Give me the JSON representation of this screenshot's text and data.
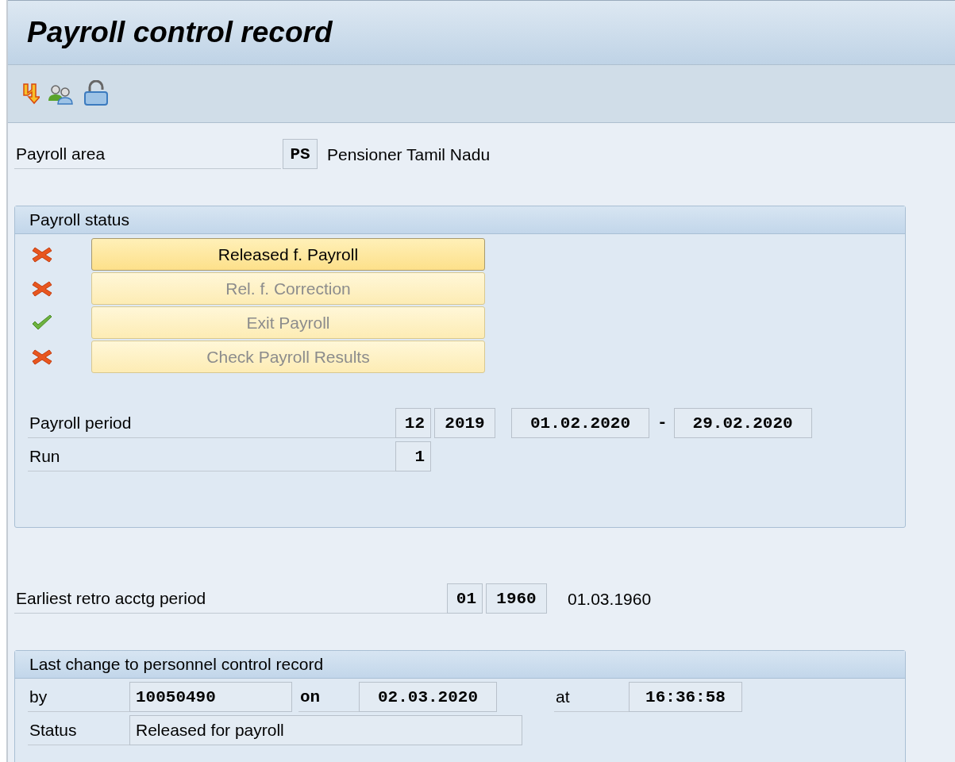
{
  "window": {
    "title": "Payroll control record"
  },
  "toolbar": [
    {
      "kind": "arrows"
    },
    {
      "kind": "persons"
    },
    {
      "kind": "lock"
    }
  ],
  "payroll_area": {
    "label": "Payroll area",
    "code": "PS",
    "name": "Pensioner Tamil Nadu"
  },
  "payroll_status": {
    "title": "Payroll status",
    "steps": [
      {
        "ok": false,
        "label": "Released f. Payroll",
        "disabled": false
      },
      {
        "ok": false,
        "label": "Rel. f. Correction",
        "disabled": true
      },
      {
        "ok": true,
        "label": "Exit Payroll",
        "disabled": true
      },
      {
        "ok": false,
        "label": "Check Payroll Results",
        "disabled": true
      }
    ],
    "period": {
      "label": "Payroll period",
      "number": "12",
      "year": "2019",
      "from": "01.02.2020",
      "separator": "-",
      "to": "29.02.2020"
    },
    "run": {
      "label": "Run",
      "value": "1"
    }
  },
  "retro": {
    "label": "Earliest retro acctg period",
    "number": "01",
    "year": "1960",
    "date": "01.03.1960"
  },
  "last_change": {
    "title": "Last change to personnel control record",
    "by_label": "by",
    "by": "10050490",
    "on_label": "on",
    "on": "02.03.2020",
    "at_label": "at",
    "at": "16:36:58",
    "status_label": "Status",
    "status": "Released for payroll"
  }
}
